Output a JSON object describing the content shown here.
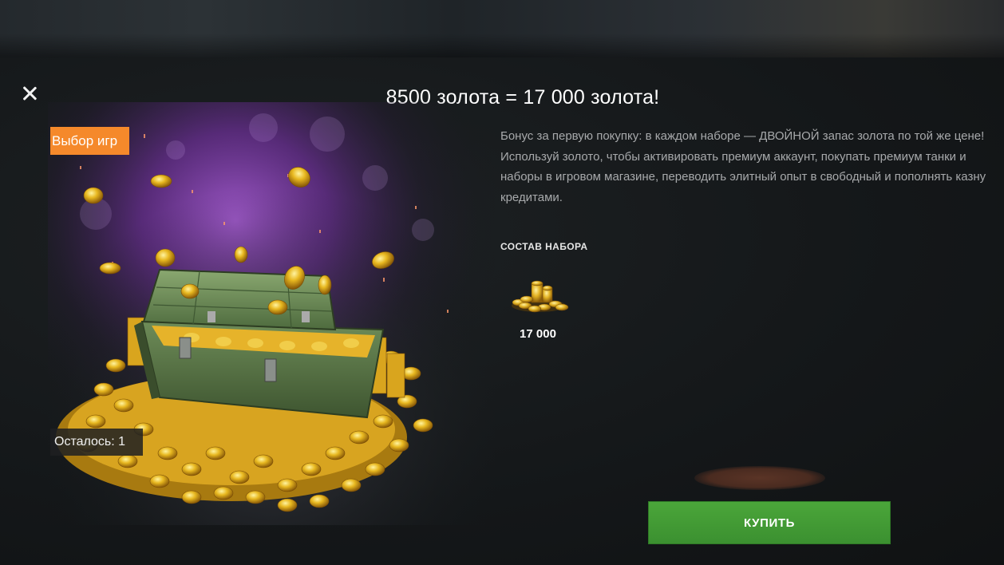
{
  "modal": {
    "title": "8500 золота = 17 000 золота!",
    "close_icon": "close-icon"
  },
  "offer": {
    "tag": "Выбор игр",
    "remaining": "Осталось: 1",
    "description": [
      "Бонус за первую покупку: в каждом наборе — ДВОЙНОЙ запас золота по той же цене!",
      "Используй золото, чтобы активировать премиум аккаунт, покупать премиум танки и наборы в игровом магазине, переводить элитный опыт в свободный и пополнять казну кредитами."
    ],
    "contents_label": "СОСТАВ НАБОРА",
    "contents": [
      {
        "icon": "gold-coins-icon",
        "quantity": "17 000"
      }
    ]
  },
  "actions": {
    "buy_label": "КУПИТЬ"
  },
  "colors": {
    "buy_button": "#45a036",
    "tag_badge": "#f5892b",
    "background": "#16191b"
  }
}
